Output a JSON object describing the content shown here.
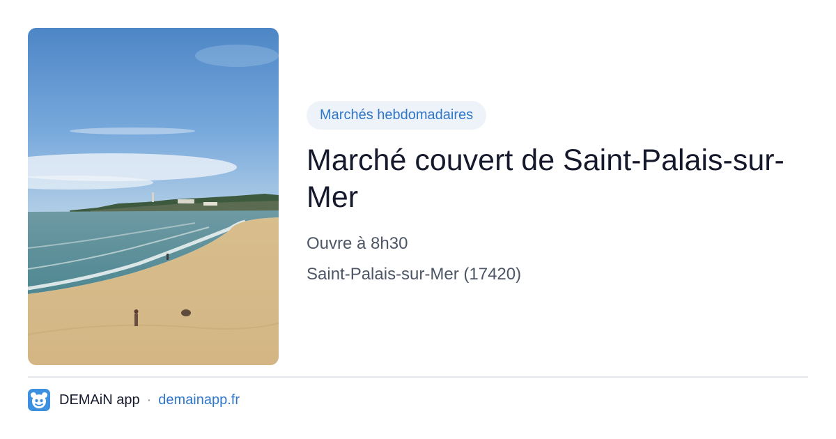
{
  "card": {
    "image": "beach-photo",
    "tag": "Marchés hebdomadaires",
    "title": "Marché couvert de Saint-Palais-sur-Mer",
    "opening": "Ouvre à 8h30",
    "location": "Saint-Palais-sur-Mer (17420)"
  },
  "footer": {
    "app_icon": "demain-app-icon",
    "app_name": "DEMAiN app",
    "separator": "·",
    "domain": "demainapp.fr"
  },
  "colors": {
    "accent": "#2f77c9",
    "tag_background": "#eef3fa",
    "title": "#15192b",
    "meta": "#4d5666",
    "divider": "#e4e8ee"
  }
}
